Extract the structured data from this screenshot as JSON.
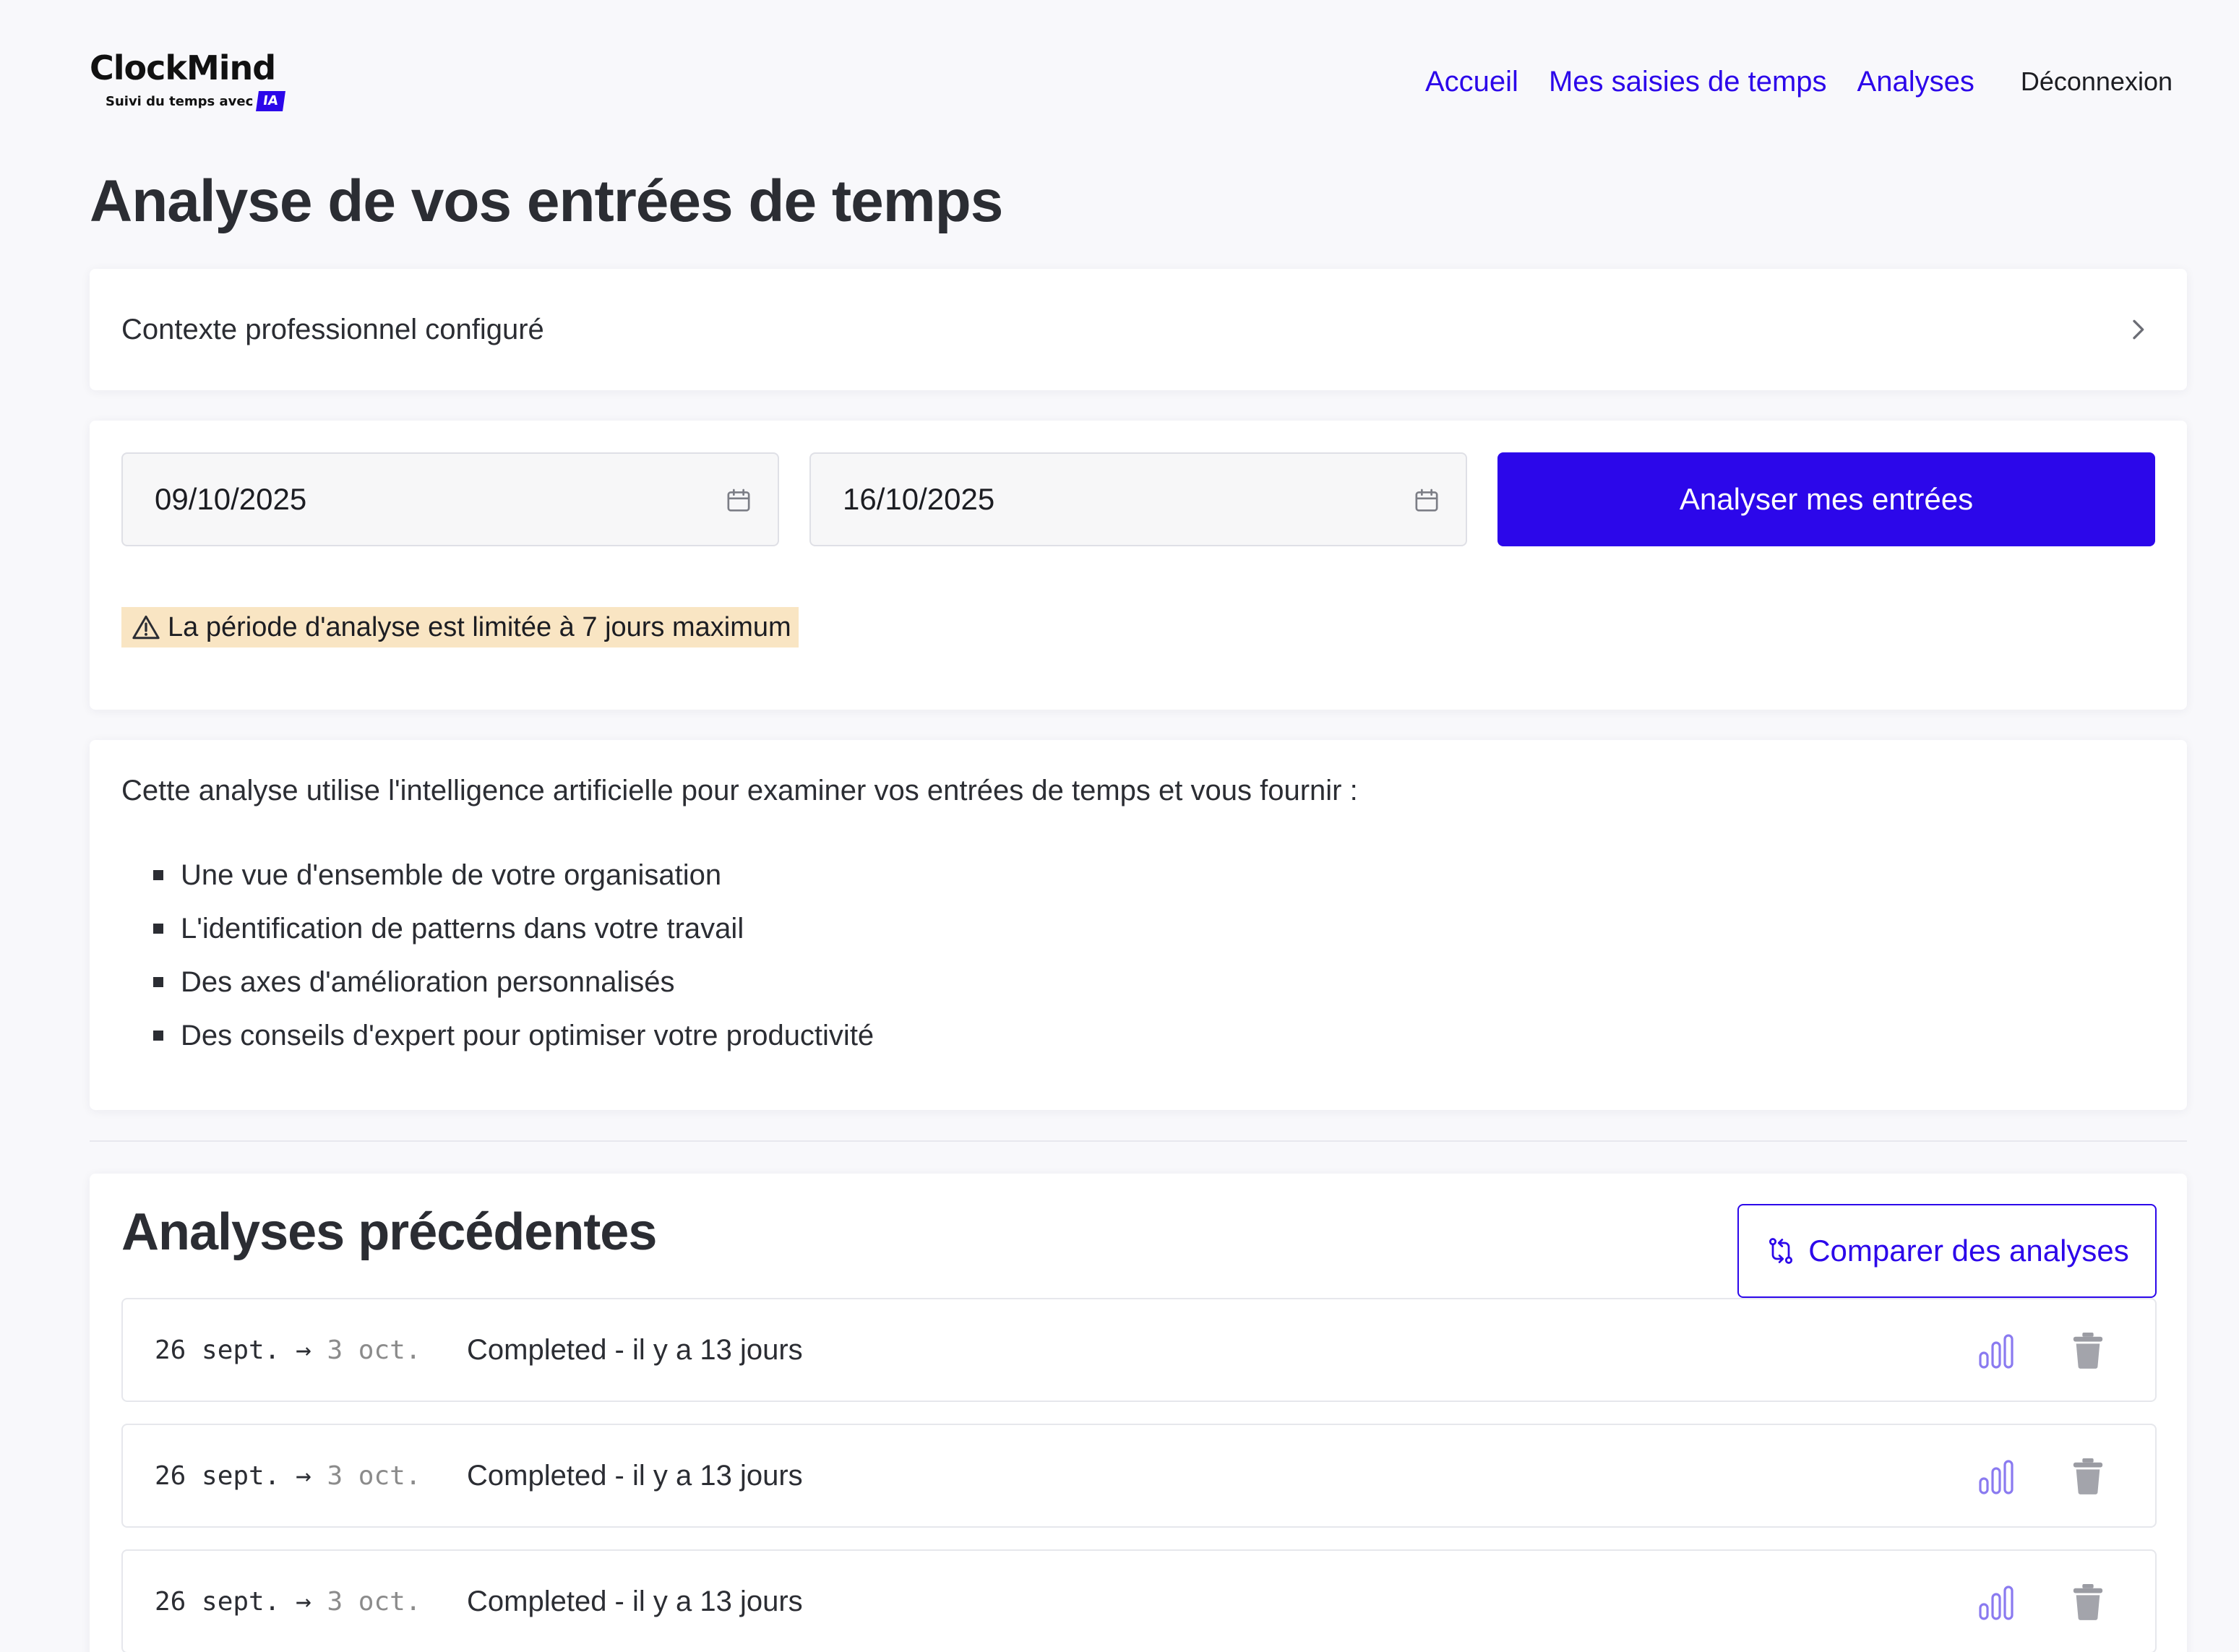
{
  "brand": {
    "name": "ClockMind",
    "tagline": "Suivi du temps avec",
    "badge": "IA",
    "accent_color": "#2c07ea"
  },
  "nav": {
    "items": [
      "Accueil",
      "Mes saisies de temps",
      "Analyses"
    ],
    "logout": "Déconnexion"
  },
  "page": {
    "title": "Analyse de vos entrées de temps"
  },
  "context": {
    "label": "Contexte professionnel configuré",
    "icon": "chevron-right-icon"
  },
  "form": {
    "start_date": "09/10/2025",
    "end_date": "16/10/2025",
    "calendar_icon": "calendar-icon",
    "submit_label": "Analyser mes entrées",
    "warning": "La période d'analyse est limitée à 7 jours maximum",
    "warning_icon": "warning-icon",
    "warning_color": "#f9e5c3"
  },
  "info": {
    "intro": "Cette analyse utilise l'intelligence artificielle pour examiner vos entrées de temps et vous fournir :",
    "items": [
      "Une vue d'ensemble de votre organisation",
      "L'identification de patterns dans votre travail",
      "Des axes d'amélioration personnalisés",
      "Des conseils d'expert pour optimiser votre productivité"
    ]
  },
  "previous": {
    "title": "Analyses précédentes",
    "compare_label": "Comparer des analyses",
    "compare_icon": "compare-arrows-icon",
    "rows": [
      {
        "start": "26 sept.",
        "arrow": "→",
        "end": "3 oct.",
        "status": "Completed - il y a 13 jours"
      },
      {
        "start": "26 sept.",
        "arrow": "→",
        "end": "3 oct.",
        "status": "Completed - il y a 13 jours"
      },
      {
        "start": "26 sept.",
        "arrow": "→",
        "end": "3 oct.",
        "status": "Completed - il y a 13 jours"
      }
    ],
    "view_icon": "bar-chart-icon",
    "delete_icon": "trash-icon"
  }
}
